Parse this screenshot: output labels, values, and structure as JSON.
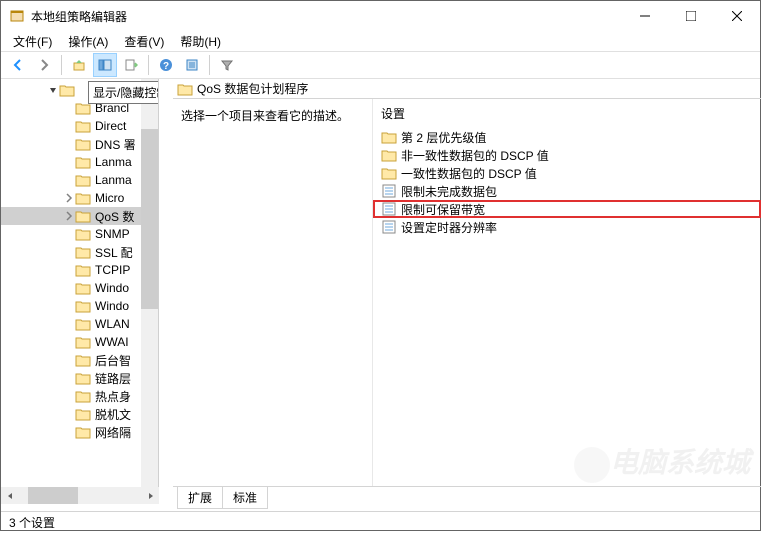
{
  "window": {
    "title": "本地组策略编辑器"
  },
  "menu": {
    "file": "文件(F)",
    "action": "操作(A)",
    "view": "查看(V)",
    "help": "帮助(H)"
  },
  "tooltip": {
    "showHideConsoleTree": "显示/隐藏控制台树"
  },
  "tree": {
    "items": [
      {
        "label": "Brancl",
        "caret": ""
      },
      {
        "label": "Direct",
        "caret": ""
      },
      {
        "label": "DNS 署",
        "caret": ""
      },
      {
        "label": "Lanma",
        "caret": ""
      },
      {
        "label": "Lanma",
        "caret": ""
      },
      {
        "label": "Micro",
        "caret": ">"
      },
      {
        "label": "QoS 数",
        "caret": ">",
        "selected": true
      },
      {
        "label": "SNMP",
        "caret": ""
      },
      {
        "label": "SSL 配",
        "caret": ""
      },
      {
        "label": "TCPIP",
        "caret": ""
      },
      {
        "label": "Windo",
        "caret": ""
      },
      {
        "label": "Windo",
        "caret": ""
      },
      {
        "label": "WLAN",
        "caret": ""
      },
      {
        "label": "WWAI",
        "caret": ""
      },
      {
        "label": "后台智",
        "caret": ""
      },
      {
        "label": "链路层",
        "caret": ""
      },
      {
        "label": "热点身",
        "caret": ""
      },
      {
        "label": "脱机文",
        "caret": ""
      },
      {
        "label": "网络隔",
        "caret": ""
      }
    ]
  },
  "right": {
    "title": "QoS 数据包计划程序",
    "description": "选择一个项目来查看它的描述。",
    "settingsHeader": "设置",
    "settings": [
      {
        "label": "第 2 层优先级值",
        "type": "folder"
      },
      {
        "label": "非一致性数据包的 DSCP 值",
        "type": "folder"
      },
      {
        "label": "一致性数据包的 DSCP 值",
        "type": "folder"
      },
      {
        "label": "限制未完成数据包",
        "type": "policy"
      },
      {
        "label": "限制可保留带宽",
        "type": "policy",
        "highlighted": true
      },
      {
        "label": "设置定时器分辨率",
        "type": "policy"
      }
    ]
  },
  "tabs": {
    "extended": "扩展",
    "standard": "标准"
  },
  "status": {
    "count": "3 个设置"
  },
  "watermark": "电脑系统城"
}
